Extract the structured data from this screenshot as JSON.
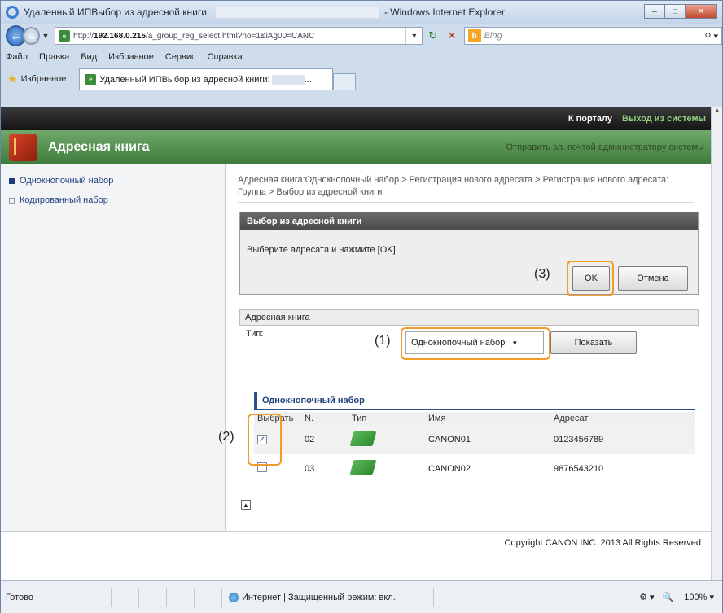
{
  "window": {
    "title_prefix": "Удаленный ИПВыбор из адресной книги:",
    "title_suffix": "- Windows Internet Explorer"
  },
  "addressbar": {
    "url_prefix": "http://",
    "url_host": "192.168.0.215",
    "url_path": "/a_group_reg_select.html?no=1&iAg00=CANC",
    "search_placeholder": "Bing"
  },
  "menu": [
    "Файл",
    "Правка",
    "Вид",
    "Избранное",
    "Сервис",
    "Справка"
  ],
  "favorites": {
    "label": "Избранное",
    "tab_title": "Удаленный ИПВыбор из адресной книги:"
  },
  "portal": {
    "to_portal": "К порталу",
    "logout": "Выход из системы"
  },
  "header": {
    "title": "Адресная книга",
    "mail_admin": "Отправить эл. почтой администратору системы"
  },
  "sidebar": {
    "items": [
      {
        "label": "Однокнопочный набор",
        "active": true
      },
      {
        "label": "Кодированный набор",
        "active": false
      }
    ]
  },
  "breadcrumb": "Адресная книга:Однокнопочный набор > Регистрация нового адресата > Регистрация нового адресата: Группа > Выбор из адресной книги",
  "select_panel": {
    "title": "Выбор из адресной книги",
    "message": "Выберите адресата и нажмите [OK].",
    "ok_label": "OK",
    "cancel_label": "Отмена"
  },
  "address_book": {
    "heading": "Адресная книга",
    "type_label": "Тип:",
    "type_value": "Однокнопочный набор",
    "show_label": "Показать"
  },
  "list": {
    "heading": "Однокнопочный набор",
    "columns": [
      "Выбрать",
      "N.",
      "Тип",
      "Имя",
      "Адресат"
    ],
    "rows": [
      {
        "checked": true,
        "number": "02",
        "name": "CANON01",
        "address": "0123456789"
      },
      {
        "checked": false,
        "number": "03",
        "name": "CANON02",
        "address": "9876543210"
      }
    ]
  },
  "callouts": [
    "(1)",
    "(2)",
    "(3)"
  ],
  "copyright": "Copyright CANON INC. 2013 All Rights Reserved",
  "status": {
    "ready": "Готово",
    "zone": "Интернет | Защищенный режим: вкл.",
    "zoom": "100%"
  },
  "colors": {
    "header_green": "#4f8c4b",
    "callout_orange": "#f39a2b",
    "link_blue": "#1f3f7f"
  }
}
